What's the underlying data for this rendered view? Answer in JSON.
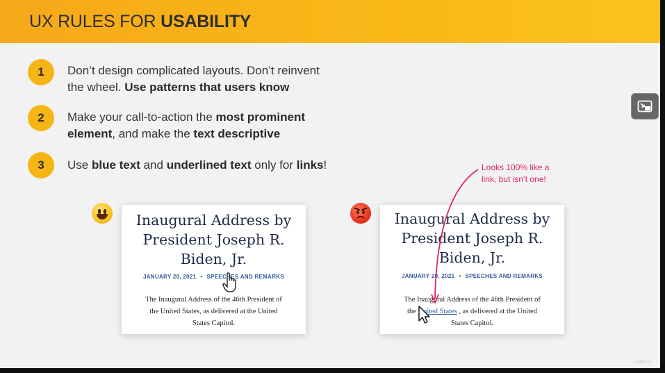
{
  "header": {
    "title_regular": "UX RULES FOR ",
    "title_bold": "USABILITY"
  },
  "rules": [
    {
      "number": "1",
      "line1_regular": "Don’t design complicated layouts. Don’t reinvent",
      "line2_regular": "the wheel. ",
      "line2_bold": "Use patterns that users know"
    },
    {
      "number": "2",
      "line1_regular": "Make your call-to-action the ",
      "line1_bold": "most prominent",
      "line2_bold": "element",
      "line2_regular": ", and make the ",
      "line2_bold2": "text descriptive"
    },
    {
      "number": "3",
      "text_1": "Use ",
      "bold_1": "blue text",
      "text_2": " and ",
      "bold_2": "underlined text",
      "text_3": " only for ",
      "bold_3": "links",
      "text_4": "!"
    }
  ],
  "good_example": {
    "emoji": "smiling-emoji",
    "title_lines": [
      "Inaugural Address by",
      "President Joseph R.",
      "Biden, Jr."
    ],
    "date": "JANUARY 20, 2021",
    "separator": "•",
    "category_link": "SPEECHES AND REMARKS",
    "body_lines": [
      "The Inaugural Address of the 46th President of",
      "the United States, as delivered at the United",
      "States Capitol."
    ]
  },
  "bad_example": {
    "emoji": "angry-emoji",
    "title_lines": [
      "Inaugural Address by",
      "President Joseph R.",
      "Biden, Jr."
    ],
    "date": "JANUARY 20, 2021",
    "separator": "•",
    "category_link": "SPEECHES AND REMARKS",
    "body_line1": "The Inaugural Address of the 46th President of",
    "body_line2_pre": "the ",
    "body_line2_link": "United States",
    "body_line2_post": " , as delivered at the United",
    "body_line3": "States Capitol.",
    "annotation_line1": "Looks 100% like a",
    "annotation_line2": "link, but isn’t one!"
  },
  "colors": {
    "header_accent": "#f8b517",
    "number_badge": "#f5b515",
    "link_blue": "#2d5a9c",
    "annotation_red": "#e0245e"
  },
  "icons": {
    "pip_button": "picture-in-picture-icon"
  },
  "watermark": "Udemy"
}
